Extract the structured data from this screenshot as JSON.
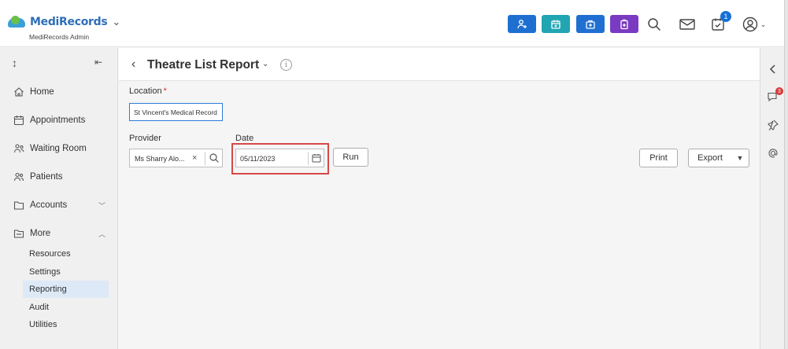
{
  "header": {
    "brand": "MediRecords",
    "brand_sub": "MediRecords Admin",
    "notification_count": "1",
    "accent_colors": {
      "blue": "#1f6fd1",
      "teal": "#22a5b3",
      "purple": "#7a3bc2"
    },
    "quick_actions": [
      "add-patient-icon",
      "add-appointment-icon",
      "medical-kit-icon",
      "clipboard-icon"
    ]
  },
  "sidebar": {
    "items": [
      {
        "label": "Home"
      },
      {
        "label": "Appointments"
      },
      {
        "label": "Waiting Room"
      },
      {
        "label": "Patients"
      },
      {
        "label": "Accounts"
      },
      {
        "label": "More"
      }
    ],
    "more_items": [
      {
        "label": "Resources"
      },
      {
        "label": "Settings"
      },
      {
        "label": "Reporting",
        "active": true
      },
      {
        "label": "Audit"
      },
      {
        "label": "Utilities"
      }
    ]
  },
  "rail": {
    "chat_badge": "3"
  },
  "page": {
    "title": "Theatre List Report",
    "location_label": "Location",
    "location_required": "*",
    "location_value": "St Vincent's Medical Record",
    "provider_label": "Provider",
    "provider_value": "Ms Sharry Alo...",
    "date_label": "Date",
    "date_value": "05/11/2023",
    "run_label": "Run",
    "print_label": "Print",
    "export_label": "Export"
  }
}
